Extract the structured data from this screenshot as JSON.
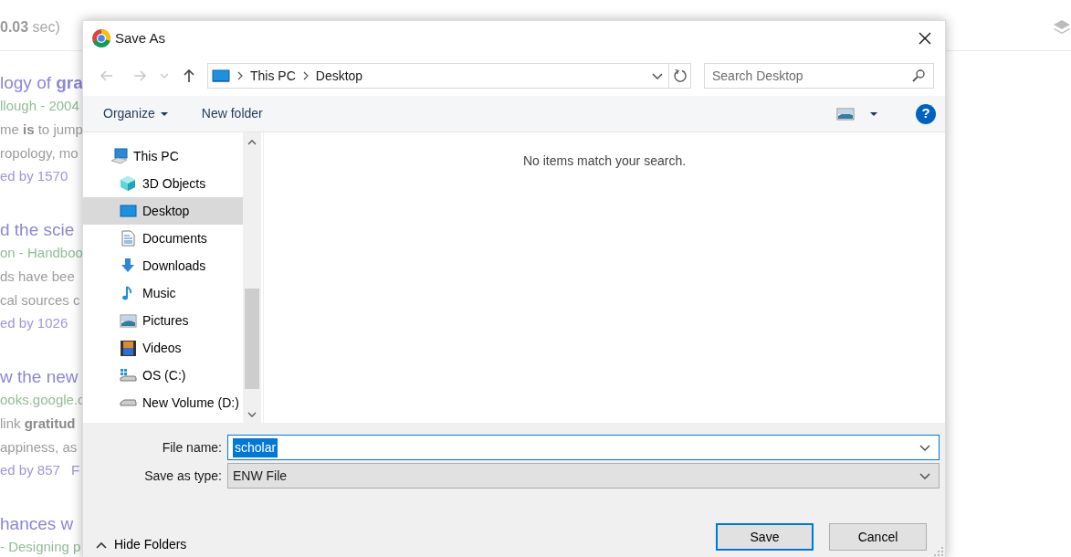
{
  "background": {
    "stats": "**0.03** sec)",
    "results": [
      {
        "title": "logy of **gra**",
        "byline_link": "llough",
        "byline": "- 2004",
        "snippet": [
          "me **is** to jump",
          "ropology, mo"
        ],
        "cited": "ed by 1570"
      },
      {
        "title": "d the scie",
        "byline": "on - Handboo",
        "snippet": [
          "ds have bee",
          "cal sources c"
        ],
        "cited": "ed by 1026"
      },
      {
        "title": "w the new",
        "byline": "ooks.google.c",
        "snippet": [
          "link **gratitud**",
          "appiness, as"
        ],
        "cited": "ed by 857",
        "extra": "F"
      },
      {
        "title": "hances w",
        "byline": "- Designing p"
      }
    ]
  },
  "dialog": {
    "title": "Save As",
    "nav_buttons": [
      {
        "kind": "back",
        "disabled": true
      },
      {
        "kind": "forward",
        "disabled": true
      },
      {
        "kind": "recent",
        "disabled": true
      },
      {
        "kind": "up",
        "disabled": false
      }
    ],
    "breadcrumb": [
      "This PC",
      "Desktop"
    ],
    "search": {
      "placeholder": "Search Desktop"
    },
    "help": "?",
    "toolbar": {
      "organize": "Organize",
      "new_folder": "New folder"
    },
    "folders": [
      {
        "label": "This PC",
        "kind": "pc",
        "selected": false,
        "children": [
          {
            "label": "3D Objects",
            "kind": "cube",
            "selected": false
          },
          {
            "label": "Desktop",
            "kind": "desktop",
            "selected": true
          },
          {
            "label": "Documents",
            "kind": "document",
            "selected": false
          },
          {
            "label": "Downloads",
            "kind": "download",
            "selected": false
          },
          {
            "label": "Music",
            "kind": "music",
            "selected": false
          },
          {
            "label": "Pictures",
            "kind": "pictures",
            "selected": false
          },
          {
            "label": "Videos",
            "kind": "videos",
            "selected": false
          },
          {
            "label": "OS (C:)",
            "kind": "osdrive",
            "selected": false
          },
          {
            "label": "New Volume (D:)",
            "kind": "drive",
            "selected": false
          }
        ]
      }
    ],
    "empty_message": "No items match your search.",
    "fields": [
      {
        "label": "File name:",
        "value": "scholar",
        "kind": "text",
        "text_selected": true
      },
      {
        "label": "Save as type:",
        "value": "ENW File",
        "kind": "select",
        "text_selected": false
      }
    ],
    "hide_folders": "Hide Folders",
    "buttons": [
      {
        "label": "Save",
        "default": true
      },
      {
        "label": "Cancel",
        "default": false
      }
    ]
  }
}
